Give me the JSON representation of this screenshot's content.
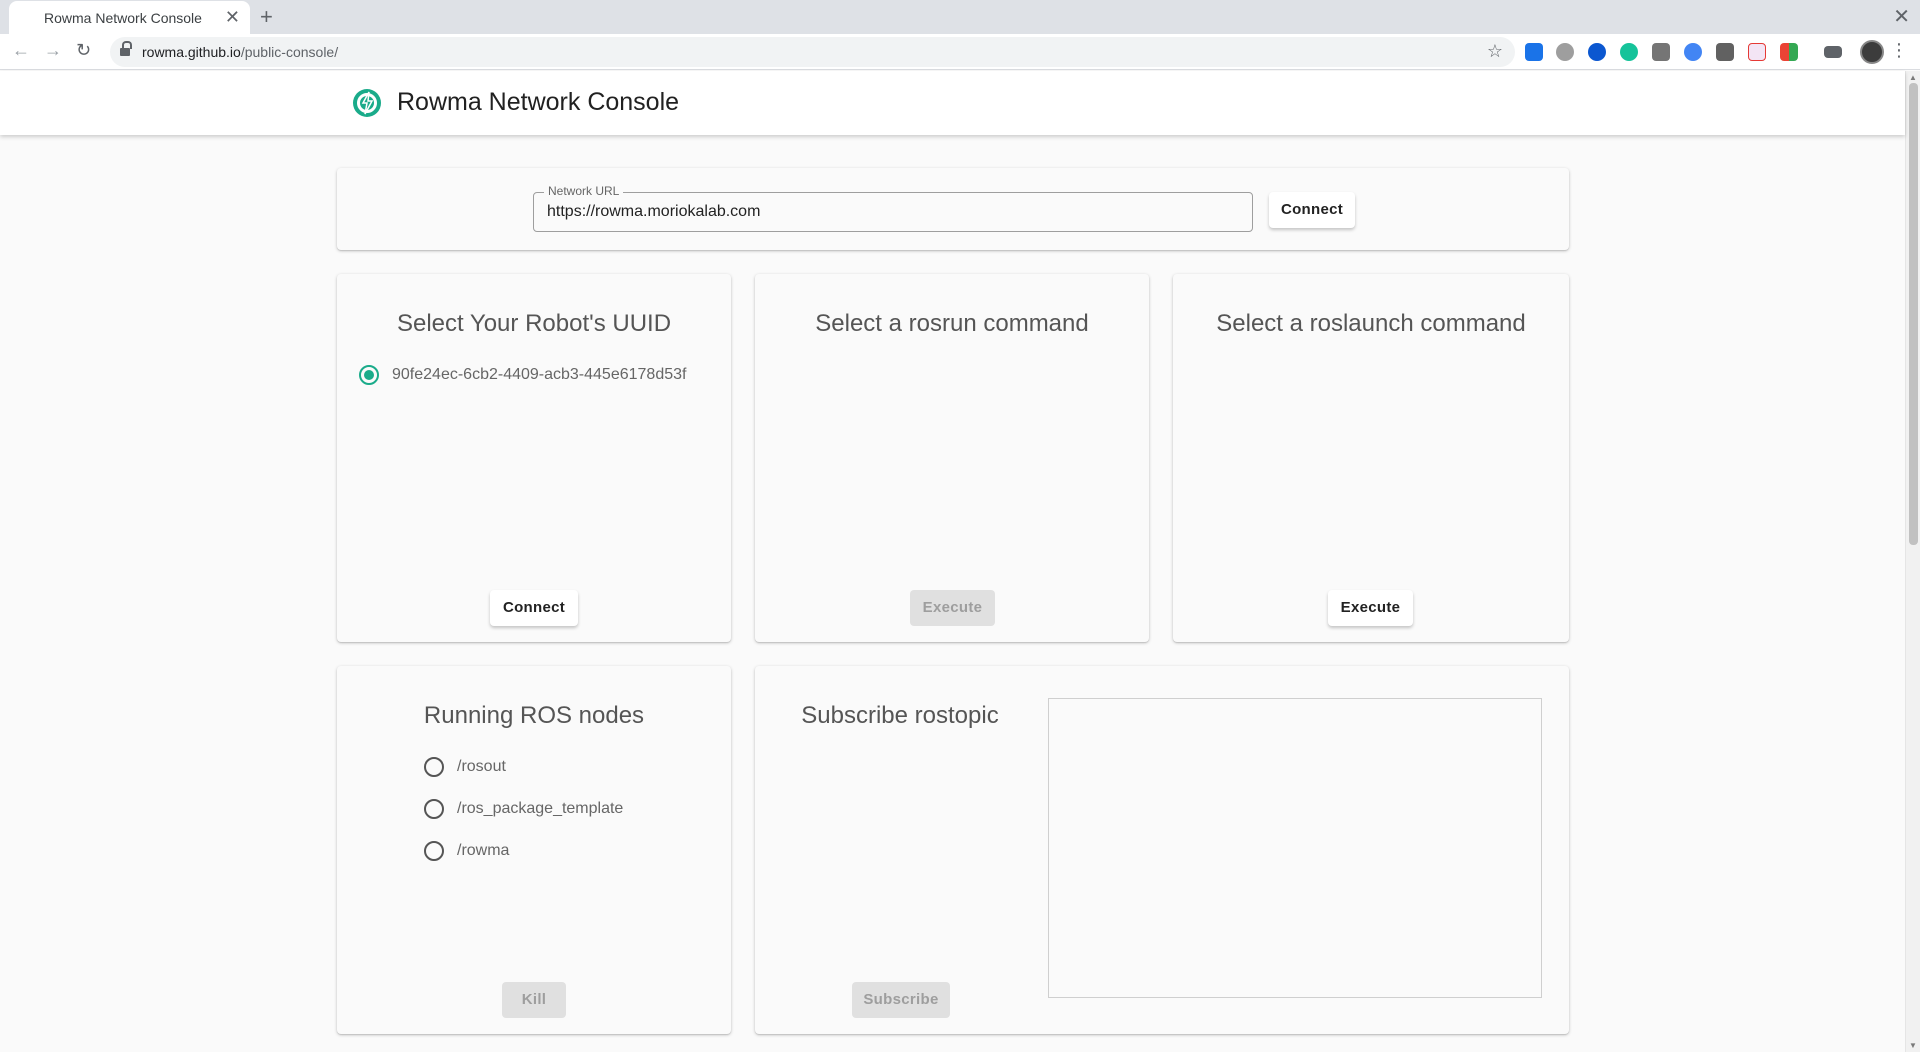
{
  "browser": {
    "tab_title": "Rowma Network Console",
    "tab_close": "✕",
    "new_tab": "+",
    "window_close": "✕",
    "back": "←",
    "forward": "→",
    "reload": "↻",
    "url_host": "rowma.github.io",
    "url_path": "/public-console/",
    "star": "☆",
    "menu": "⋮"
  },
  "app": {
    "title": "Rowma Network Console",
    "accent_color": "#1aab8a"
  },
  "network": {
    "label": "Network URL",
    "value": "https://rowma.moriokalab.com",
    "connect_label": "Connect"
  },
  "uuid_card": {
    "title": "Select Your Robot's UUID",
    "items": [
      {
        "label": "90fe24ec-6cb2-4409-acb3-445e6178d53f",
        "checked": true
      }
    ],
    "connect_label": "Connect"
  },
  "rosrun_card": {
    "title": "Select a rosrun command",
    "execute_label": "Execute"
  },
  "roslaunch_card": {
    "title": "Select a roslaunch command",
    "execute_label": "Execute"
  },
  "nodes_card": {
    "title": "Running ROS nodes",
    "nodes": [
      {
        "label": "/rosout",
        "checked": false
      },
      {
        "label": "/ros_package_template",
        "checked": false
      },
      {
        "label": "/rowma",
        "checked": false
      }
    ],
    "kill_label": "Kill"
  },
  "topic_card": {
    "title": "Subscribe rostopic",
    "subscribe_label": "Subscribe",
    "output": ""
  }
}
